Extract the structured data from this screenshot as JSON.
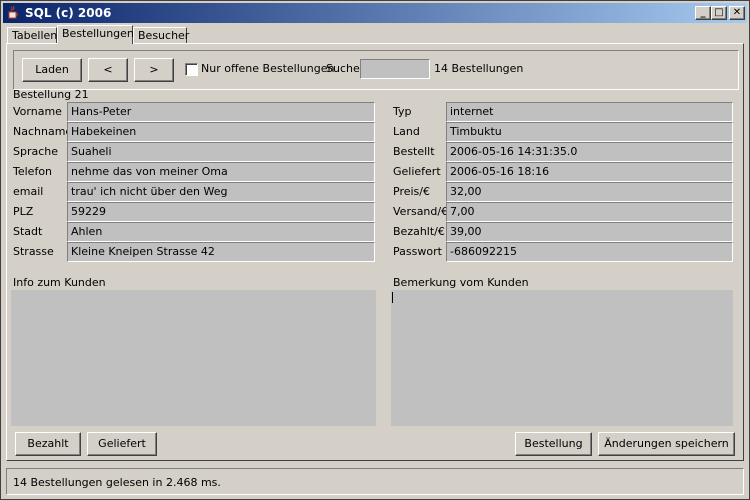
{
  "window": {
    "title": "SQL (c) 2006",
    "minimize_label": "_",
    "maximize_label": "□",
    "close_label": "✕"
  },
  "tabs": [
    {
      "label": "Tabellen",
      "active": false
    },
    {
      "label": "Bestellungen",
      "active": true
    },
    {
      "label": "Besucher",
      "active": false
    }
  ],
  "toolbar": {
    "load_label": "Laden",
    "prev_label": "<",
    "next_label": ">",
    "open_orders_label": "Nur offene Bestellungen",
    "open_orders_checked": false,
    "search_label": "Suche",
    "search_value": "",
    "count_text": "14 Bestellungen"
  },
  "order": {
    "heading": "Bestellung 21",
    "customer": [
      {
        "label": "Vorname",
        "value": "Hans-Peter"
      },
      {
        "label": "Nachname",
        "value": "Habekeinen"
      },
      {
        "label": "Sprache",
        "value": "Suaheli"
      },
      {
        "label": "Telefon",
        "value": "nehme das von meiner Oma"
      },
      {
        "label": "email",
        "value": "trau' ich nicht über den Weg"
      },
      {
        "label": "PLZ",
        "value": "59229"
      },
      {
        "label": "Stadt",
        "value": "Ahlen"
      },
      {
        "label": "Strasse",
        "value": "Kleine Kneipen Strasse 42"
      }
    ],
    "details": [
      {
        "label": "Typ",
        "value": "internet"
      },
      {
        "label": "Land",
        "value": "Timbuktu"
      },
      {
        "label": "Bestellt",
        "value": "2006-05-16 14:31:35.0"
      },
      {
        "label": "Geliefert",
        "value": "2006-05-16 18:16"
      },
      {
        "label": "Preis/€",
        "value": "32,00"
      },
      {
        "label": "Versand/€",
        "value": "7,00"
      },
      {
        "label": "Bezahlt/€",
        "value": "39,00"
      },
      {
        "label": "Passwort",
        "value": "-686092215"
      }
    ],
    "info_label": "Info zum Kunden",
    "info_value": "",
    "remark_label": "Bemerkung vom Kunden",
    "remark_value": ""
  },
  "actions": {
    "paid_label": "Bezahlt",
    "delivered_label": "Geliefert",
    "order_label": "Bestellung",
    "save_label": "Änderungen speichern"
  },
  "status": {
    "text": "14 Bestellungen gelesen  in 2.468 ms."
  }
}
